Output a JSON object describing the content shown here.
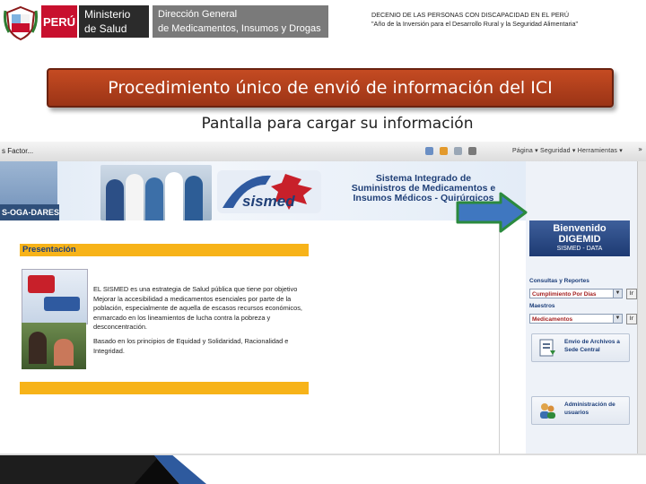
{
  "header": {
    "peru": "PERÚ",
    "ministerio_line1": "Ministerio",
    "ministerio_line2": "de Salud",
    "direccion_line1": "Dirección General",
    "direccion_line2": "de Medicamentos, Insumos y Drogas",
    "decenio_line1": "DECENIO DE LAS PERSONAS CON DISCAPACIDAD EN EL PERÚ",
    "decenio_line2": "\"Año de la Inversión para el Desarrollo Rural y la Seguridad Alimentaria\""
  },
  "banner": {
    "title": "Procedimiento único de envió de información del ICI"
  },
  "subtitle": "Pantalla para cargar su información",
  "browser": {
    "tab_label": "s Factor...",
    "toolbar_items": "Página ▾   Seguridad ▾   Herramientas ▾",
    "overflow": "»"
  },
  "site": {
    "code_label": "S-OGA-DARES",
    "title_line1": "Sistema Integrado de",
    "title_line2": "Suministros de Medicamentos e",
    "title_line3": "Insumos Médicos - Quirúrgicos",
    "logo_text": "sismed"
  },
  "presentation": {
    "title": "Presentación",
    "para1": "EL SISMED es una estrategia de Salud pública que tiene por objetivo Mejorar la accesibilidad a medicamentos esenciales por parte de la población, especialmente de aquella de escasos recursos económicos, enmarcado en los lineamientos de lucha contra la pobreza y desconcentración.",
    "para2": "Basado en los principios de Equidad y Solidaridad, Racionalidad e Integridad."
  },
  "sidebar": {
    "welcome_line1": "Bienvenido",
    "welcome_line2": "DIGEMID",
    "welcome_line3": "SISMED - DATA",
    "consultas_label": "Consultas y Reportes",
    "consultas_value": "Cumplimiento Por Dias",
    "maestros_label": "Maestros",
    "maestros_value": "Medicamentos",
    "go_label": "Ir",
    "envio_line1": "Envio de Archivos a",
    "envio_line2": "Sede Central",
    "admin_line1": "Administración de",
    "admin_line2": "usuarios"
  },
  "colors": {
    "banner": "#b03e1b",
    "accent_yellow": "#f7b319",
    "brand_blue": "#1c3e7a",
    "arrow": "#3f77c0"
  }
}
